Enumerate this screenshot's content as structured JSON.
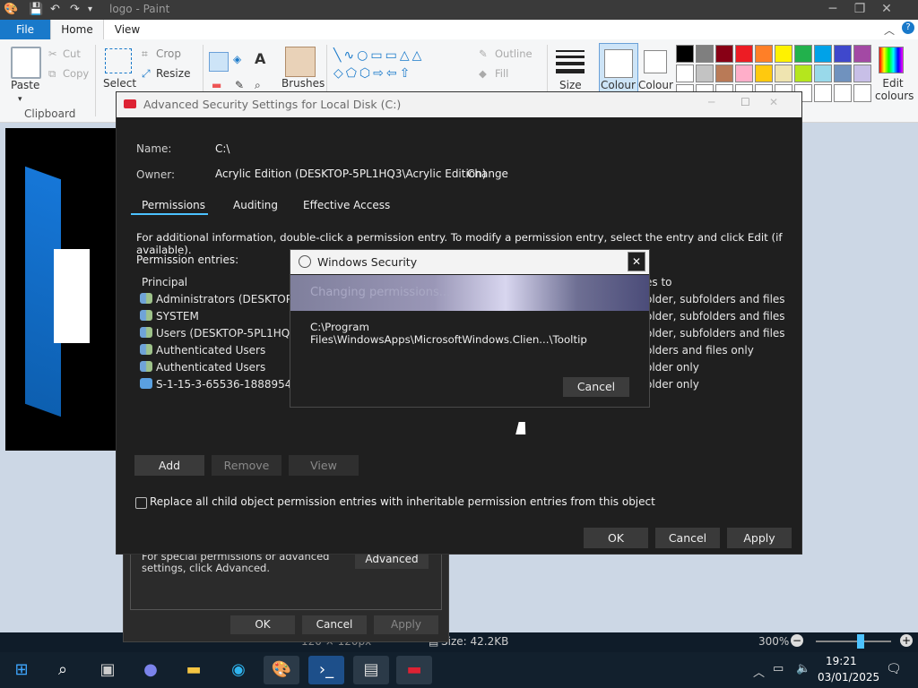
{
  "paint": {
    "title": "logo - Paint",
    "tabs": [
      "File",
      "Home",
      "View"
    ],
    "clipboard": {
      "paste": "Paste",
      "cut": "Cut",
      "copy": "Copy",
      "group": "Clipboard"
    },
    "image": {
      "crop": "Crop",
      "resize": "Resize",
      "select": "Select"
    },
    "brushes": "Brushes",
    "shapes": {
      "outline": "Outline",
      "fill": "Fill"
    },
    "size": "Size",
    "colour1": "Colour",
    "colour2": "Colour",
    "edit_colours": "Edit colours",
    "status": {
      "dimensions": "120 × 120px",
      "file_size": "Size: 42.2KB",
      "zoom": "300%"
    }
  },
  "palette": [
    "#000000",
    "#7f7f7f",
    "#880015",
    "#ed1c24",
    "#ff7f27",
    "#fff200",
    "#22b14c",
    "#00a2e8",
    "#3f48cc",
    "#a349a4",
    "#ffffff",
    "#c3c3c3",
    "#b97a57",
    "#ffaec9",
    "#ffc90e",
    "#efe4b0",
    "#b5e61d",
    "#99d9ea",
    "#7092be",
    "#c8bfe7"
  ],
  "adv": {
    "title": "Advanced Security Settings for Local Disk (C:)",
    "name_label": "Name:",
    "name_value": "C:\\",
    "owner_label": "Owner:",
    "owner_value": "Acrylic Edition (DESKTOP-5PL1HQ3\\Acrylic Edition)",
    "change": "Change",
    "tabs": [
      "Permissions",
      "Auditing",
      "Effective Access"
    ],
    "info": "For additional information, double-click a permission entry. To modify a permission entry, select the entry and click Edit (if available).",
    "entries_label": "Permission entries:",
    "principal_header": "Principal",
    "applies_header": "es to",
    "principals": [
      "Administrators (DESKTOP-5P",
      "SYSTEM",
      "Users (DESKTOP-5PL1HQ3\\U",
      "Authenticated Users",
      "Authenticated Users",
      "S-1-15-3-65536-1888954469-"
    ],
    "applies": [
      "older, subfolders and files",
      "older, subfolders and files",
      "older, subfolders and files",
      "olders and files only",
      "older only",
      "older only"
    ],
    "add": "Add",
    "remove": "Remove",
    "view": "View",
    "replace_checkbox": "Replace all child object permission entries with inheritable permission entries from this object",
    "ok": "OK",
    "cancel": "Cancel",
    "apply": "Apply"
  },
  "props": {
    "text": "For special permissions or advanced settings, click Advanced.",
    "advanced": "Advanced",
    "ok": "OK",
    "cancel": "Cancel",
    "apply": "Apply"
  },
  "ws": {
    "title": "Windows Security",
    "banner": "Changing permissions...",
    "path": "C:\\Program Files\\WindowsApps\\MicrosoftWindows.Clien...\\Tooltip",
    "cancel": "Cancel"
  },
  "taskbar": {
    "time": "19:21",
    "date": "03/01/2025"
  }
}
